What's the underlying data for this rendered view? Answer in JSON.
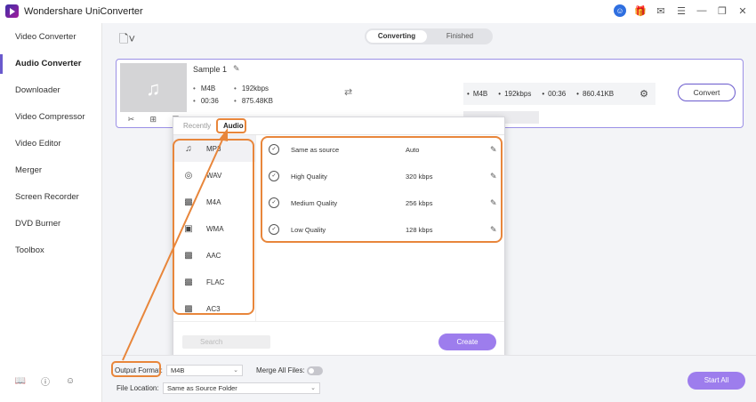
{
  "app": {
    "title": "Wondershare UniConverter"
  },
  "sidebar": {
    "items": [
      {
        "label": "Video Converter"
      },
      {
        "label": "Audio Converter"
      },
      {
        "label": "Downloader"
      },
      {
        "label": "Video Compressor"
      },
      {
        "label": "Video Editor"
      },
      {
        "label": "Merger"
      },
      {
        "label": "Screen Recorder"
      },
      {
        "label": "DVD Burner"
      },
      {
        "label": "Toolbox"
      }
    ],
    "active_index": 1
  },
  "tabs": {
    "converting": "Converting",
    "finished": "Finished"
  },
  "file": {
    "name": "Sample 1",
    "format": "M4B",
    "bitrate": "192kbps",
    "duration": "00:36",
    "size": "875.48KB",
    "target": {
      "format": "M4B",
      "bitrate": "192kbps",
      "duration": "00:36",
      "size": "860.41KB"
    },
    "convert_label": "Convert"
  },
  "popup": {
    "tab_recently": "Recently",
    "tab_audio": "Audio",
    "categories": [
      {
        "label": "MP3",
        "icon": "music-note-icon"
      },
      {
        "label": "WAV",
        "icon": "wav-icon"
      },
      {
        "label": "M4A",
        "icon": "m4a-icon"
      },
      {
        "label": "WMA",
        "icon": "wma-icon"
      },
      {
        "label": "AAC",
        "icon": "aac-icon"
      },
      {
        "label": "FLAC",
        "icon": "flac-icon"
      },
      {
        "label": "AC3",
        "icon": "ac3-icon"
      }
    ],
    "qualities": [
      {
        "name": "Same as source",
        "rate": "Auto"
      },
      {
        "name": "High Quality",
        "rate": "320 kbps"
      },
      {
        "name": "Medium Quality",
        "rate": "256 kbps"
      },
      {
        "name": "Low Quality",
        "rate": "128 kbps"
      }
    ],
    "search_placeholder": "Search",
    "create_label": "Create"
  },
  "bottom": {
    "output_format_label": "Output Format:",
    "output_format_value": "M4B",
    "merge_label": "Merge All Files:",
    "file_location_label": "File Location:",
    "file_location_value": "Same as Source Folder",
    "start_all_label": "Start All"
  },
  "colors": {
    "accent": "#6a5acd",
    "annotation": "#e8863b",
    "button": "#9d7ded"
  }
}
